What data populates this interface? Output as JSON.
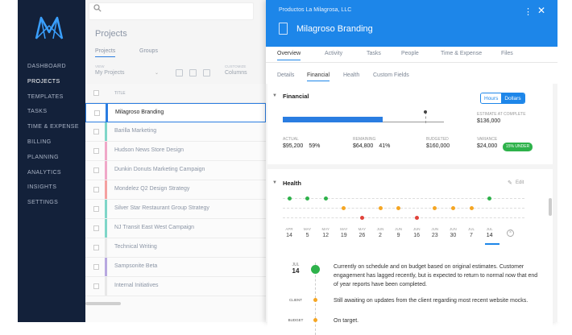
{
  "colors": {
    "green": "#2eb24b",
    "orange": "#f5a623",
    "red": "#e0423a",
    "blue": "#1d86e9",
    "navy": "#13213a"
  },
  "sidebar": {
    "logo": "mavenlink-logo",
    "items": [
      {
        "label": "DASHBOARD",
        "active": false
      },
      {
        "label": "PROJECTS",
        "active": true
      },
      {
        "label": "TEMPLATES",
        "active": false
      },
      {
        "label": "TASKS",
        "active": false
      },
      {
        "label": "TIME & EXPENSE",
        "active": false
      },
      {
        "label": "BILLING",
        "active": false
      },
      {
        "label": "PLANNING",
        "active": false
      },
      {
        "label": "ANALYTICS",
        "active": false
      },
      {
        "label": "INSIGHTS",
        "active": false
      },
      {
        "label": "SETTINGS",
        "active": false
      }
    ]
  },
  "projects": {
    "title": "Projects",
    "tabs": [
      "Projects",
      "Groups"
    ],
    "filters": {
      "view_label": "VIEW",
      "view_value": "My Projects",
      "customize_label": "CUSTOMIZE",
      "customize_value": "Columns"
    },
    "column_header": "TITLE",
    "rows": [
      {
        "name": "Milagroso Branding",
        "color": "#2a7de1",
        "selected": true
      },
      {
        "name": "Barilla Marketing",
        "color": "#7fd6c8",
        "selected": false
      },
      {
        "name": "Hudson News Store Design",
        "color": "#f0a8c8",
        "selected": false
      },
      {
        "name": "Dunkin Donuts Marketing Campaign",
        "color": "#f0a8c8",
        "selected": false
      },
      {
        "name": "Mondelez Q2 Design Strategy",
        "color": "#f4a0a0",
        "selected": false
      },
      {
        "name": "Silver Star Restaurant Group Strategy",
        "color": "#7fd6c8",
        "selected": false
      },
      {
        "name": "NJ Transit East West Campaign",
        "color": "#7fd6c8",
        "selected": false
      },
      {
        "name": "Technical Writing",
        "color": "#e8e8e8",
        "selected": false
      },
      {
        "name": "Sampsonite Beta",
        "color": "#b8a8e0",
        "selected": false
      },
      {
        "name": "Internal Initiatives",
        "color": "#e8e8e8",
        "selected": false
      }
    ]
  },
  "detail": {
    "client": "Productos La Milagrosa, LLC",
    "title": "Milagroso Branding",
    "tabs": [
      "Overview",
      "Activity",
      "Tasks",
      "People",
      "Time & Expense",
      "Files"
    ],
    "active_tab": "Overview",
    "subtabs": [
      "Details",
      "Financial",
      "Health",
      "Custom Fields"
    ],
    "active_subtab": "Financial",
    "financial": {
      "title": "Financial",
      "toggle": [
        "Hours",
        "Dollars"
      ],
      "toggle_selected": "Dollars",
      "estimate_label": "ESTIMATE AT COMPLETE",
      "estimate_value": "$136,000",
      "actual_fraction": 0.59,
      "stats": [
        {
          "label": "ACTUAL",
          "value": "$95,200",
          "pct": "59%"
        },
        {
          "label": "REMAINING",
          "value": "$64,800",
          "pct": "41%"
        },
        {
          "label": "BUDGETED",
          "value": "$160,000",
          "pct": ""
        },
        {
          "label": "VARIANCE",
          "value": "$24,000",
          "pct": ""
        }
      ],
      "variance_badge": "15% UNDER"
    },
    "health": {
      "title": "Health",
      "edit_label": "Edit",
      "timeline": [
        {
          "month": "APR",
          "day": "14",
          "status": "green"
        },
        {
          "month": "MAY",
          "day": "5",
          "status": "green"
        },
        {
          "month": "MAY",
          "day": "12",
          "status": "green"
        },
        {
          "month": "MAY",
          "day": "19",
          "status": "orange"
        },
        {
          "month": "MAY",
          "day": "26",
          "status": "red"
        },
        {
          "month": "JUN",
          "day": "2",
          "status": "orange"
        },
        {
          "month": "JUN",
          "day": "9",
          "status": "orange"
        },
        {
          "month": "JUN",
          "day": "16",
          "status": "red"
        },
        {
          "month": "JUN",
          "day": "23",
          "status": "orange"
        },
        {
          "month": "JUN",
          "day": "30",
          "status": "orange"
        },
        {
          "month": "JUL",
          "day": "7",
          "status": "orange"
        },
        {
          "month": "JUL",
          "day": "14",
          "status": "green"
        }
      ],
      "entries": [
        {
          "month": "JUL",
          "day": "14",
          "label": "",
          "status": "green",
          "text": "Currently on schedule and on budget based on original estimates. Customer engagement has lagged recently, but is expected to return to normal now that end of year reports have been completed."
        },
        {
          "month": "",
          "day": "",
          "label": "CLIENT",
          "status": "orange",
          "text": "Still awaiting on updates from the client regarding most recent website mocks."
        },
        {
          "month": "",
          "day": "",
          "label": "BUDGET",
          "status": "orange",
          "text": "On target."
        }
      ]
    }
  }
}
